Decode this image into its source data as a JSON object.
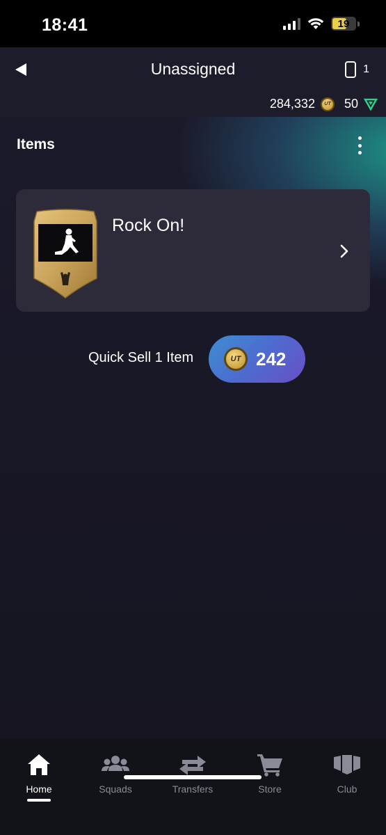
{
  "status_bar": {
    "time": "18:41",
    "battery": "19",
    "icons": [
      "cellular-signal-icon",
      "wifi-icon",
      "battery-icon"
    ]
  },
  "header": {
    "title": "Unassigned",
    "pile_count": "1"
  },
  "currency": {
    "coins": "284,332",
    "points": "50",
    "coin_glyph": "UT"
  },
  "section": {
    "title": "Items"
  },
  "item": {
    "name": "Rock On!"
  },
  "quick_sell": {
    "label": "Quick Sell 1 Item",
    "value": "242"
  },
  "nav": {
    "items": [
      {
        "label": "Home",
        "icon": "home-icon",
        "active": true
      },
      {
        "label": "Squads",
        "icon": "squads-icon",
        "active": false
      },
      {
        "label": "Transfers",
        "icon": "transfers-icon",
        "active": false
      },
      {
        "label": "Store",
        "icon": "store-icon",
        "active": false
      },
      {
        "label": "Club",
        "icon": "club-icon",
        "active": false
      }
    ]
  },
  "colors": {
    "background": "#181726",
    "card": "#2d2b3a",
    "accent_gradient_start": "#3d8fd1",
    "accent_gradient_end": "#6a4fc7",
    "nav_inactive": "#8b8b98"
  }
}
